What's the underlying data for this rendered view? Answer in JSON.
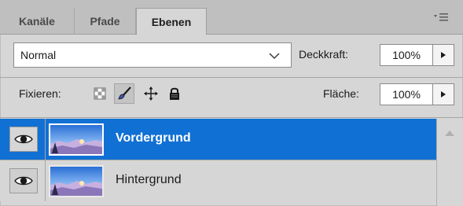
{
  "tabs": [
    {
      "label": "Kanäle",
      "active": false
    },
    {
      "label": "Pfade",
      "active": false
    },
    {
      "label": "Ebenen",
      "active": true
    }
  ],
  "blend_mode": {
    "value": "Normal"
  },
  "opacity": {
    "label": "Deckkraft:",
    "value": "100%"
  },
  "lock": {
    "label": "Fixieren:",
    "icons": [
      "lock-transparent-pixels-icon",
      "lock-image-pixels-brush-icon",
      "lock-position-move-icon",
      "lock-all-padlock-icon"
    ]
  },
  "fill": {
    "label": "Fläche:",
    "value": "100%"
  },
  "layers": [
    {
      "name": "Vordergrund",
      "selected": true,
      "visible": true
    },
    {
      "name": "Hintergrund",
      "selected": false,
      "visible": true
    }
  ],
  "colors": {
    "panel_bg": "#d6d6d6",
    "tabbar_bg": "#bfbfbf",
    "selection": "#1170d3"
  }
}
